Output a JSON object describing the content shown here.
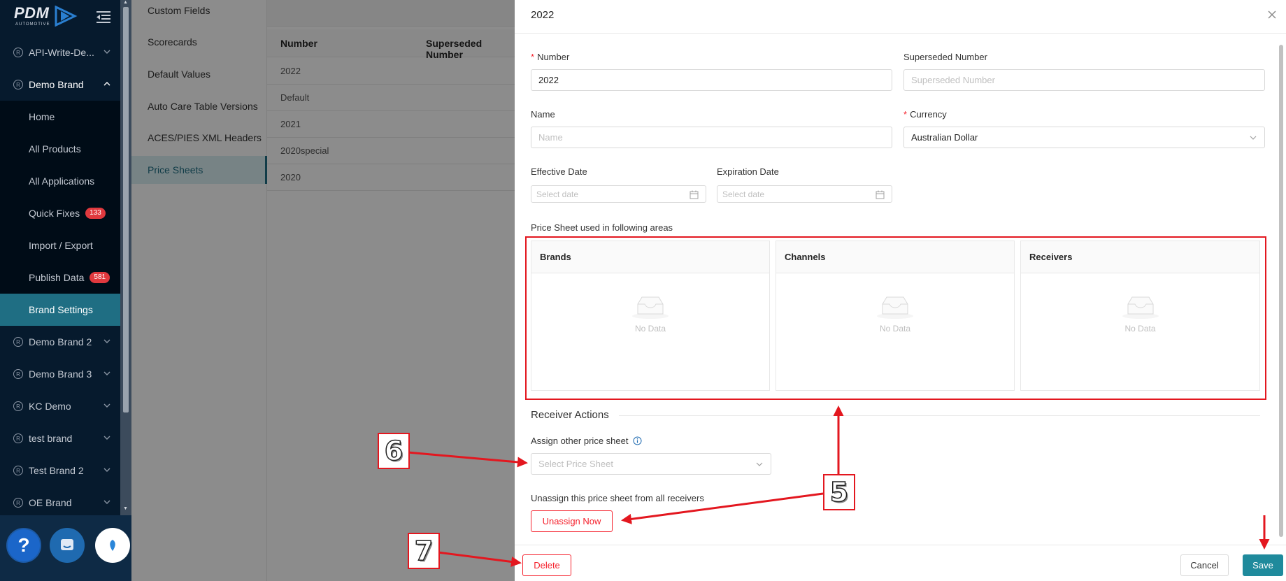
{
  "nav": {
    "logo_text": "PDM",
    "logo_sub": "AUTOMOTIVE",
    "items": [
      {
        "label": "API-Write-De...",
        "type": "brand"
      },
      {
        "label": "Demo Brand",
        "type": "brand-open"
      },
      {
        "label": "Home",
        "type": "sub"
      },
      {
        "label": "All Products",
        "type": "sub"
      },
      {
        "label": "All Applications",
        "type": "sub"
      },
      {
        "label": "Quick Fixes",
        "type": "sub",
        "badge": "133"
      },
      {
        "label": "Import / Export",
        "type": "sub"
      },
      {
        "label": "Publish Data",
        "type": "sub",
        "badge": "581"
      },
      {
        "label": "Brand Settings",
        "type": "active"
      },
      {
        "label": "Demo Brand 2",
        "type": "brand"
      },
      {
        "label": "Demo Brand 3",
        "type": "brand"
      },
      {
        "label": "KC Demo",
        "type": "brand"
      },
      {
        "label": "test brand",
        "type": "brand"
      },
      {
        "label": "Test Brand 2",
        "type": "brand"
      },
      {
        "label": "OE Brand",
        "type": "brand"
      }
    ],
    "brand_marker": "R",
    "help_label": "?"
  },
  "settings_menu": {
    "items": [
      "Custom Fields",
      "Scorecards",
      "Default Values",
      "Auto Care Table Versions",
      "ACES/PIES XML Headers",
      "Price Sheets"
    ],
    "active": "Price Sheets"
  },
  "list": {
    "col_number": "Number",
    "col_superseded": "Superseded Number",
    "rows": [
      "2022",
      "Default",
      "2021",
      "2020special",
      "2020"
    ]
  },
  "drawer": {
    "title": "2022",
    "number_label": "Number",
    "number_value": "2022",
    "superseded_label": "Superseded Number",
    "superseded_placeholder": "Superseded Number",
    "name_label": "Name",
    "name_placeholder": "Name",
    "currency_label": "Currency",
    "currency_value": "Australian Dollar",
    "effective_label": "Effective Date",
    "effective_placeholder": "Select date",
    "expiration_label": "Expiration Date",
    "expiration_placeholder": "Select date",
    "areas_title": "Price Sheet used in following areas",
    "panels": [
      {
        "title": "Brands",
        "empty": "No Data"
      },
      {
        "title": "Channels",
        "empty": "No Data"
      },
      {
        "title": "Receivers",
        "empty": "No Data"
      }
    ],
    "receiver_actions_title": "Receiver Actions",
    "assign_label": "Assign other price sheet",
    "assign_placeholder": "Select Price Sheet",
    "unassign_label": "Unassign this price sheet from all receivers",
    "unassign_button": "Unassign Now",
    "delete_button": "Delete",
    "cancel_button": "Cancel",
    "save_button": "Save"
  },
  "annotations": {
    "callout_5": "5",
    "callout_6": "6",
    "callout_7": "7",
    "color": "#e3171f"
  },
  "colors": {
    "accent": "#1f8a9c",
    "nav_bg": "#061a2d",
    "danger": "#f5222d"
  }
}
